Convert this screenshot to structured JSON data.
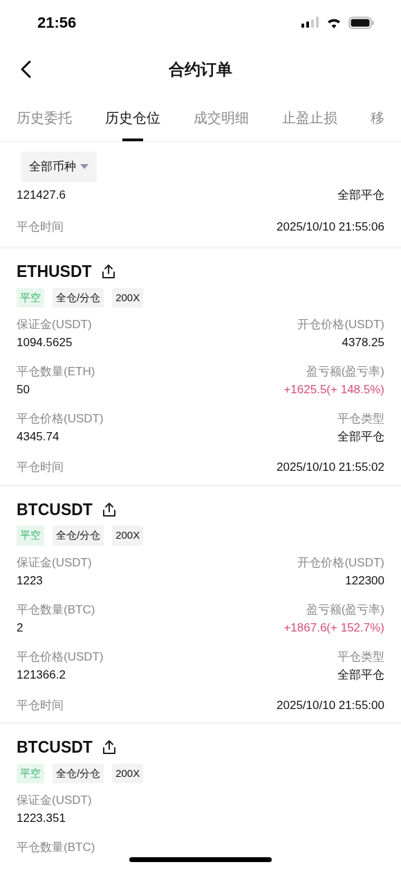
{
  "status_bar": {
    "time": "21:56"
  },
  "nav": {
    "title": "合约订单"
  },
  "tabs": [
    {
      "label": "历史委托",
      "selected": false
    },
    {
      "label": "历史仓位",
      "selected": true
    },
    {
      "label": "成交明细",
      "selected": false
    },
    {
      "label": "止盈止损",
      "selected": false
    },
    {
      "label": "移",
      "selected": false
    }
  ],
  "filter": {
    "label": "全部币种"
  },
  "partial_card": {
    "left_value": "121427.6",
    "right_value": "全部平仓",
    "time_label": "平仓时间",
    "time": "2025/10/10 21:55:06"
  },
  "cards": [
    {
      "symbol": "ETHUSDT",
      "tags": [
        {
          "text": "平空",
          "kind": "side"
        },
        {
          "text": "全仓/分仓",
          "kind": "plain"
        },
        {
          "text": "200X",
          "kind": "plain"
        }
      ],
      "rows": [
        {
          "left": {
            "label": "保证金(USDT)",
            "value": "1094.5625"
          },
          "right": {
            "label": "开仓价格(USDT)",
            "value": "4378.25",
            "color": "#111111"
          }
        },
        {
          "left": {
            "label": "平仓数量(ETH)",
            "value": "50"
          },
          "right": {
            "label": "盈亏额(盈亏率)",
            "value": "+1625.5(+ 148.5%)",
            "color": "#d64f76"
          }
        },
        {
          "left": {
            "label": "平仓价格(USDT)",
            "value": "4345.74"
          },
          "right": {
            "label": "平仓类型",
            "value": "全部平仓",
            "color": "#111111"
          }
        }
      ],
      "time_label": "平仓时间",
      "time": "2025/10/10 21:55:02"
    },
    {
      "symbol": "BTCUSDT",
      "tags": [
        {
          "text": "平空",
          "kind": "side"
        },
        {
          "text": "全仓/分仓",
          "kind": "plain"
        },
        {
          "text": "200X",
          "kind": "plain"
        }
      ],
      "rows": [
        {
          "left": {
            "label": "保证金(USDT)",
            "value": "1223"
          },
          "right": {
            "label": "开仓价格(USDT)",
            "value": "122300",
            "color": "#111111"
          }
        },
        {
          "left": {
            "label": "平仓数量(BTC)",
            "value": "2"
          },
          "right": {
            "label": "盈亏额(盈亏率)",
            "value": "+1867.6(+ 152.7%)",
            "color": "#d64f76"
          }
        },
        {
          "left": {
            "label": "平仓价格(USDT)",
            "value": "121366.2"
          },
          "right": {
            "label": "平仓类型",
            "value": "全部平仓",
            "color": "#111111"
          }
        }
      ],
      "time_label": "平仓时间",
      "time": "2025/10/10 21:55:00"
    },
    {
      "symbol": "BTCUSDT",
      "tags": [
        {
          "text": "平空",
          "kind": "side"
        },
        {
          "text": "全仓/分仓",
          "kind": "plain"
        },
        {
          "text": "200X",
          "kind": "plain"
        }
      ],
      "rows": [
        {
          "left": {
            "label": "保证金(USDT)",
            "value": "1223.351"
          }
        },
        {
          "left": {
            "label": "平仓数量(BTC)"
          }
        }
      ]
    }
  ]
}
